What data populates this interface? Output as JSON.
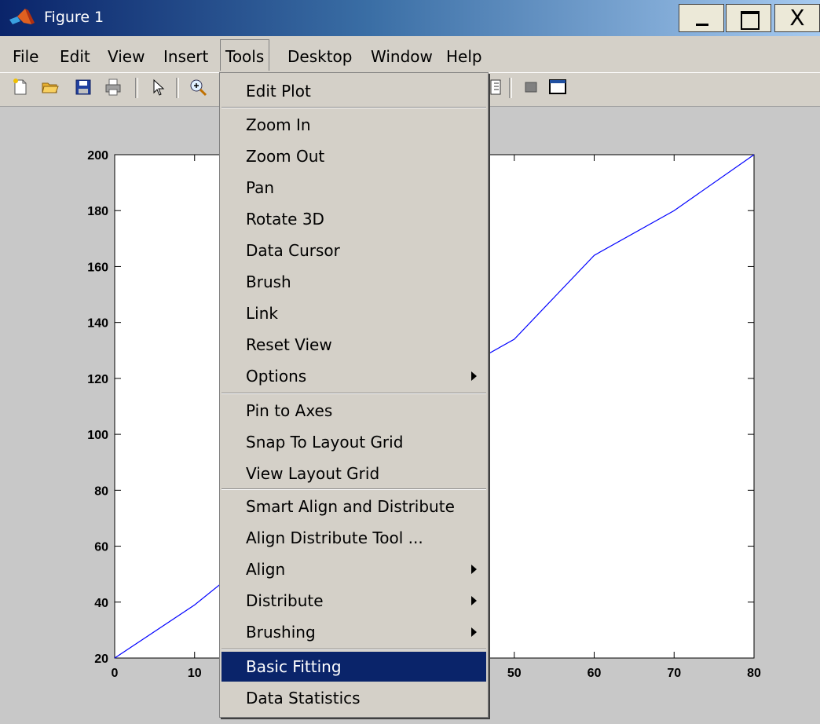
{
  "window": {
    "title": "Figure 1",
    "close_glyph": "X"
  },
  "menubar": [
    "File",
    "Edit",
    "View",
    "Insert",
    "Tools",
    "Desktop",
    "Window",
    "Help"
  ],
  "toolbar_icons": [
    "new-figure-icon",
    "open-file-icon",
    "save-icon",
    "print-icon",
    "select-arrow-icon",
    "zoom-in-icon",
    "data-cursor-icon",
    "hide-plot-tools-icon",
    "show-plot-tools-icon"
  ],
  "tools_menu": {
    "items": [
      {
        "label": "Edit Plot"
      },
      {
        "label": "Zoom In"
      },
      {
        "label": "Zoom Out"
      },
      {
        "label": "Pan"
      },
      {
        "label": "Rotate 3D"
      },
      {
        "label": "Data Cursor"
      },
      {
        "label": "Brush"
      },
      {
        "label": "Link"
      },
      {
        "label": "Reset View"
      },
      {
        "label": "Options",
        "submenu": true
      },
      {
        "label": "Pin to Axes"
      },
      {
        "label": "Snap To Layout Grid"
      },
      {
        "label": "View Layout Grid"
      },
      {
        "label": "Smart Align and Distribute"
      },
      {
        "label": "Align Distribute Tool ..."
      },
      {
        "label": "Align",
        "submenu": true
      },
      {
        "label": "Distribute",
        "submenu": true
      },
      {
        "label": "Brushing",
        "submenu": true
      },
      {
        "label": "Basic Fitting",
        "selected": true
      },
      {
        "label": "Data Statistics"
      }
    ]
  },
  "chart_data": {
    "type": "line",
    "x": [
      0,
      10,
      20,
      30,
      40,
      50,
      55,
      60,
      70,
      80
    ],
    "y": [
      20,
      39,
      62,
      84,
      118,
      134,
      149,
      164,
      180,
      200
    ],
    "xlim": [
      0,
      80
    ],
    "ylim": [
      20,
      200
    ],
    "xticks": [
      0,
      10,
      20,
      30,
      40,
      50,
      60,
      70,
      80
    ],
    "yticks": [
      20,
      40,
      60,
      80,
      100,
      120,
      140,
      160,
      180,
      200
    ],
    "visible_xtick_labels": [
      "0",
      "10",
      "50",
      "60",
      "70",
      "80"
    ],
    "color": "#0000ff",
    "grid": false
  }
}
